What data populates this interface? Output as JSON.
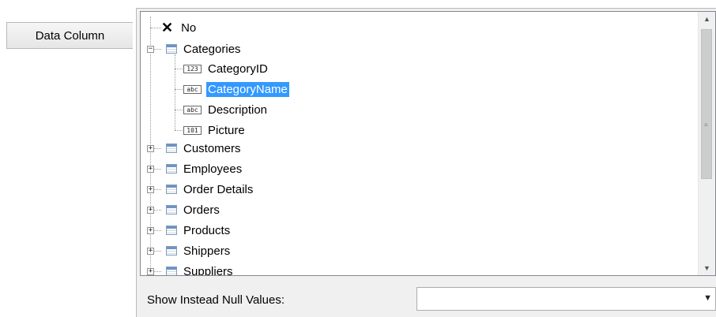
{
  "tabs": {
    "data_column": "Data Column"
  },
  "tree": {
    "none_label": "No",
    "categories_label": "Categories",
    "category_fields": [
      {
        "label": "CategoryID",
        "type_badge": "123",
        "icon": "number-field-icon"
      },
      {
        "label": "CategoryName",
        "type_badge": "abc",
        "icon": "text-field-icon",
        "selected": true
      },
      {
        "label": "Description",
        "type_badge": "abc",
        "icon": "text-field-icon"
      },
      {
        "label": "Picture",
        "type_badge": "101",
        "icon": "binary-field-icon"
      }
    ],
    "tables": [
      "Customers",
      "Employees",
      "Order Details",
      "Orders",
      "Products",
      "Shippers",
      "Suppliers"
    ]
  },
  "null_values": {
    "label": "Show Instead Null Values:",
    "value": ""
  },
  "colors": {
    "selection": "#3399ff",
    "panel": "#f0f0f0",
    "border": "#828790"
  }
}
